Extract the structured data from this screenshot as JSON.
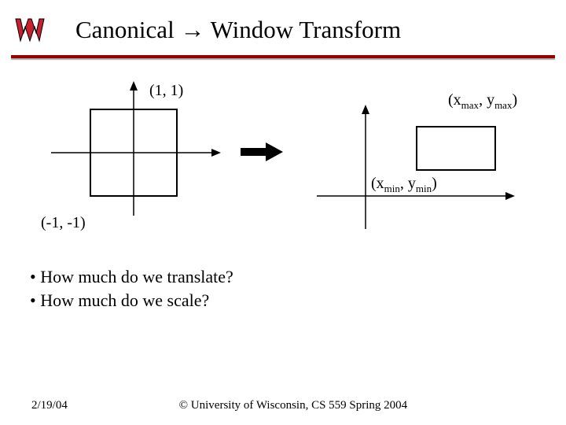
{
  "title": "Canonical → Window Transform",
  "labels": {
    "top_left_corner": "(1, 1)",
    "bottom_left_corner": "(-1, -1)",
    "right_max_open": "(x",
    "right_max_mid_a": ", y",
    "right_max_close": ")",
    "right_max_sub": "max",
    "right_min_open": "(x",
    "right_min_mid_a": ", y",
    "right_min_close": ")",
    "right_min_sub": "min"
  },
  "bullets": [
    "How much do we translate?",
    "How much do we scale?"
  ],
  "footer": {
    "date": "2/19/04",
    "copyright": "© University of Wisconsin, CS 559 Spring 2004"
  }
}
